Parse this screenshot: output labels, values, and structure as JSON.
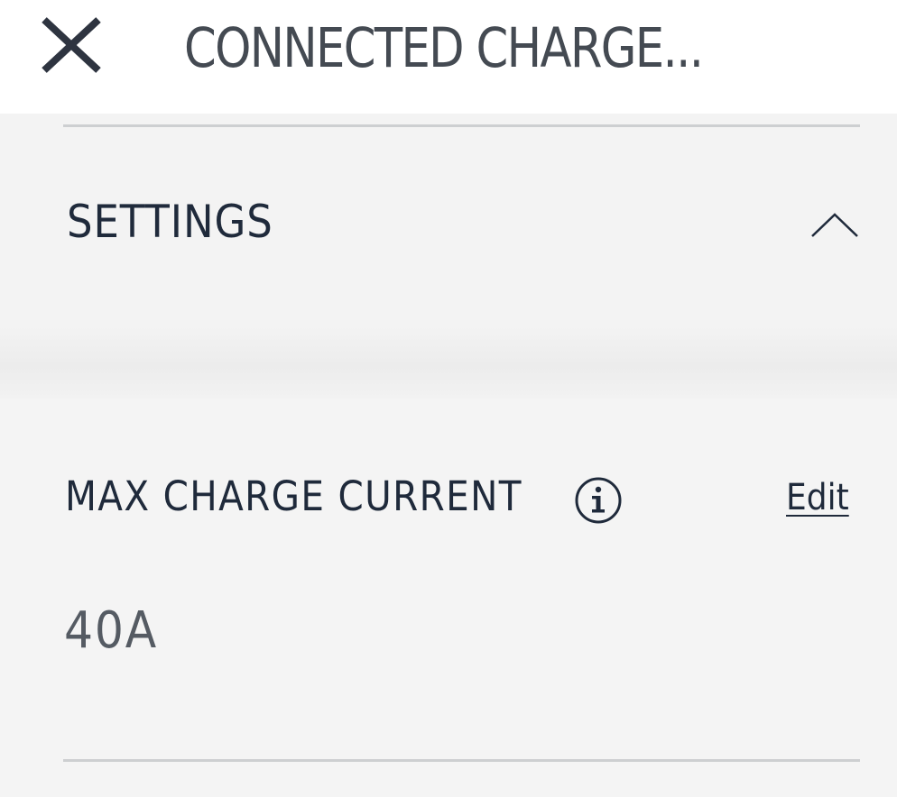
{
  "header": {
    "title": "CONNECTED CHARGE...",
    "close_icon": "close-icon"
  },
  "settings": {
    "label": "SETTINGS",
    "toggle_icon": "chevron-up-icon",
    "expanded": true
  },
  "max_charge_current": {
    "label": "MAX CHARGE CURRENT",
    "info_icon": "info-icon",
    "edit_label": "Edit",
    "value": "40A"
  },
  "colors": {
    "text_primary": "#1f2a3b",
    "text_secondary": "#555b63",
    "title": "#444a52",
    "header_bg": "#ffffff",
    "page_bg": "#f3f3f3",
    "divider": "#cdcfd1"
  }
}
